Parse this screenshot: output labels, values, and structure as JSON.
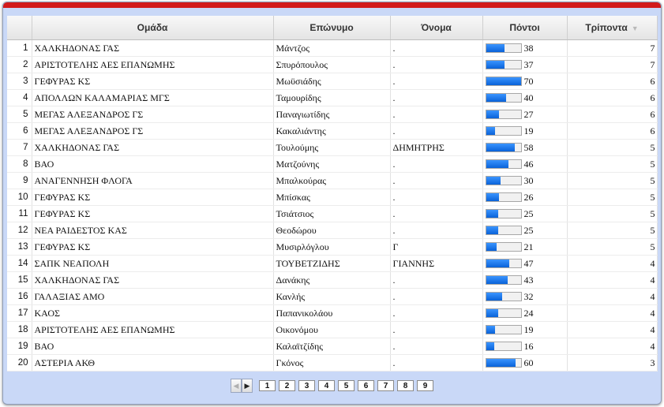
{
  "colors": {
    "accent_bar": "#d21a1a",
    "frame_bg": "#c9d8f7",
    "progress_fill": "#0a63d8"
  },
  "columns": [
    "Ομάδα",
    "Επώνυμο",
    "Όνομα",
    "Πόντοι",
    "Τρίποντα"
  ],
  "sort_indicator": "▼",
  "rows": [
    {
      "idx": "1",
      "team": "ΧΑΛΚΗΔΟΝΑΣ ΓΑΣ",
      "surname": "Μάντζος",
      "name": ".",
      "points": 38,
      "threes": "7"
    },
    {
      "idx": "2",
      "team": "ΑΡΙΣΤΟΤΕΛΗΣ ΑΕΣ ΕΠΑΝΩΜΗΣ",
      "surname": "Σπυρόπουλος",
      "name": ".",
      "points": 37,
      "threes": "7"
    },
    {
      "idx": "3",
      "team": "ΓΕΦΥΡΑΣ ΚΣ",
      "surname": "Μωϋσιάδης",
      "name": ".",
      "points": 70,
      "threes": "6"
    },
    {
      "idx": "4",
      "team": "ΑΠΟΛΛΩΝ ΚΑΛΑΜΑΡΙΑΣ ΜΓΣ",
      "surname": "Ταμουρίδης",
      "name": ".",
      "points": 40,
      "threes": "6"
    },
    {
      "idx": "5",
      "team": "ΜΕΓΑΣ ΑΛΕΞΑΝΔΡΟΣ ΓΣ",
      "surname": "Παναγιωτίδης",
      "name": ".",
      "points": 27,
      "threes": "6"
    },
    {
      "idx": "6",
      "team": "ΜΕΓΑΣ ΑΛΕΞΑΝΔΡΟΣ ΓΣ",
      "surname": "Κακαλιάντης",
      "name": ".",
      "points": 19,
      "threes": "6"
    },
    {
      "idx": "7",
      "team": "ΧΑΛΚΗΔΟΝΑΣ ΓΑΣ",
      "surname": "Τουλούμης",
      "name": "ΔΗΜΗΤΡΗΣ",
      "points": 58,
      "threes": "5"
    },
    {
      "idx": "8",
      "team": "ΒΑΟ",
      "surname": "Ματζούνης",
      "name": ".",
      "points": 46,
      "threes": "5"
    },
    {
      "idx": "9",
      "team": "ΑΝΑΓΕΝΝΗΣΗ ΦΛΟΓΑ",
      "surname": "Μπαλκούρας",
      "name": ".",
      "points": 30,
      "threes": "5"
    },
    {
      "idx": "10",
      "team": "ΓΕΦΥΡΑΣ ΚΣ",
      "surname": "Μπίσκας",
      "name": ".",
      "points": 26,
      "threes": "5"
    },
    {
      "idx": "11",
      "team": "ΓΕΦΥΡΑΣ ΚΣ",
      "surname": "Τσιάτσιος",
      "name": ".",
      "points": 25,
      "threes": "5"
    },
    {
      "idx": "12",
      "team": "ΝΕΑ ΡΑΙΔΕΣΤΟΣ ΚΑΣ",
      "surname": "Θεοδώρου",
      "name": ".",
      "points": 25,
      "threes": "5"
    },
    {
      "idx": "13",
      "team": "ΓΕΦΥΡΑΣ ΚΣ",
      "surname": "Μυσιρλόγλου",
      "name": "Γ",
      "points": 21,
      "threes": "5"
    },
    {
      "idx": "14",
      "team": "ΣΑΠΚ ΝΕΑΠΟΛΗ",
      "surname": "ΤΟΥΒΕΤΖΙΔΗΣ",
      "name": "ΓΙΑΝΝΗΣ",
      "points": 47,
      "threes": "4"
    },
    {
      "idx": "15",
      "team": "ΧΑΛΚΗΔΟΝΑΣ ΓΑΣ",
      "surname": "Δανάκης",
      "name": ".",
      "points": 43,
      "threes": "4"
    },
    {
      "idx": "16",
      "team": "ΓΑΛΑΞΙΑΣ ΑΜΟ",
      "surname": "Κανλής",
      "name": ".",
      "points": 32,
      "threes": "4"
    },
    {
      "idx": "17",
      "team": "ΚΑΟΣ",
      "surname": "Παπανικολάου",
      "name": ".",
      "points": 24,
      "threes": "4"
    },
    {
      "idx": "18",
      "team": "ΑΡΙΣΤΟΤΕΛΗΣ ΑΕΣ ΕΠΑΝΩΜΗΣ",
      "surname": "Οικονόμου",
      "name": ".",
      "points": 19,
      "threes": "4"
    },
    {
      "idx": "19",
      "team": "ΒΑΟ",
      "surname": "Καλαϊτζίδης",
      "name": ".",
      "points": 16,
      "threes": "4"
    },
    {
      "idx": "20",
      "team": "ΑΣΤΕΡΙΑ ΑΚΘ",
      "surname": "Γκόνος",
      "name": ".",
      "points": 60,
      "threes": "3"
    }
  ],
  "points_max": 70,
  "pager": {
    "prev_icon": "◀",
    "next_icon": "▶",
    "pages": [
      "1",
      "2",
      "3",
      "4",
      "5",
      "6",
      "7",
      "8",
      "9"
    ],
    "current": "1"
  }
}
